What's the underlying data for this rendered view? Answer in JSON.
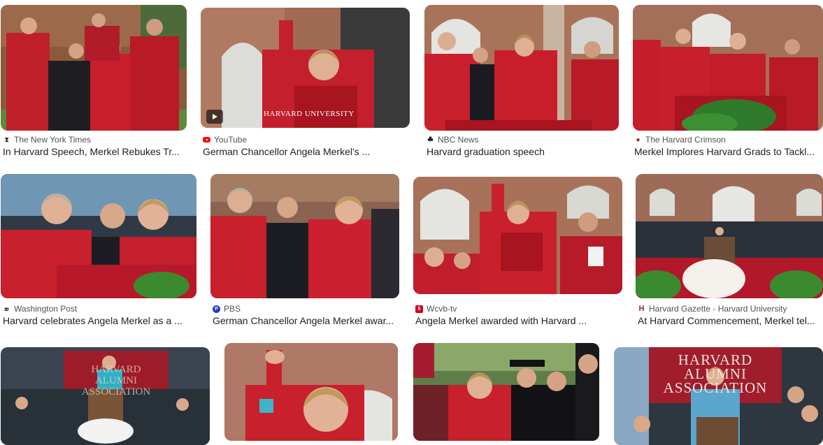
{
  "results": [
    {
      "source": "The New York Times",
      "title": "In Harvard Speech, Merkel Rebukes Tr...",
      "favicon": "nyt-icon",
      "favicon_color": "#000000"
    },
    {
      "source": "YouTube",
      "title": "German Chancellor Angela Merkel's ...",
      "favicon": "youtube-icon",
      "favicon_color": "#ff0000",
      "watermark": "HARVARD UNIVERSITY"
    },
    {
      "source": "NBC News",
      "title": "Harvard graduation speech",
      "favicon": "nbc-icon",
      "favicon_color": "#000000"
    },
    {
      "source": "The Harvard Crimson",
      "title": "Merkel Implores Harvard Grads to Tackl...",
      "favicon": "crimson-icon",
      "favicon_color": "#a51c30"
    },
    {
      "source": "Washington Post",
      "title": "Harvard celebrates Angela Merkel as a ...",
      "favicon": "wapo-icon",
      "favicon_color": "#000000"
    },
    {
      "source": "PBS",
      "title": "German Chancellor Angela Merkel awar...",
      "favicon": "pbs-icon",
      "favicon_color": "#2638c4"
    },
    {
      "source": "Wcvb-tv",
      "title": "Angela Merkel awarded with Harvard ...",
      "favicon": "wcvb-icon",
      "favicon_color": "#d0021b"
    },
    {
      "source": "Harvard Gazette - Harvard University",
      "title": "At Harvard Commencement, Merkel tel...",
      "favicon": "harvard-gazette-icon",
      "favicon_color": "#a51c30"
    },
    {
      "banner": "HARVARD ALUMNI ASSOCIATION"
    },
    {},
    {},
    {
      "banner": "HARVARD ALUMNI ASSOCIATION"
    }
  ]
}
